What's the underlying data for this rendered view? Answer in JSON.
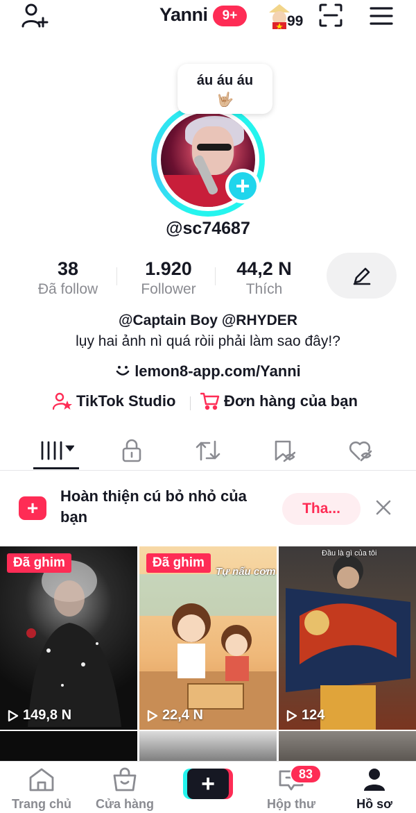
{
  "header": {
    "username": "Yanni",
    "notification_badge": "9+",
    "coin_count": "99",
    "icons": [
      "add-friend-icon",
      "avatar-sticker-icon",
      "scan-icon",
      "menu-icon"
    ]
  },
  "profile": {
    "status_bubble": "áu áu áu",
    "status_emoji": "🤟🏼",
    "handle": "@sc74687",
    "stats": [
      {
        "value": "38",
        "label": "Đã follow"
      },
      {
        "value": "1.920",
        "label": "Follower"
      },
      {
        "value": "44,2 N",
        "label": "Thích"
      }
    ],
    "bio_mentions": "@Captain Boy @RHYDER",
    "bio_text": "lụy hai ảnh nì quá ròii phải làm sao đây!?",
    "link": "lemon8-app.com/Yanni",
    "actions": [
      {
        "label": "TikTok Studio",
        "icon": "studio-icon"
      },
      {
        "label": "Đơn hàng của bạn",
        "icon": "cart-icon"
      }
    ]
  },
  "tabs": [
    {
      "name": "videos",
      "icon": "grid-icon",
      "active": true
    },
    {
      "name": "private",
      "icon": "lock-icon"
    },
    {
      "name": "reposts",
      "icon": "repost-icon"
    },
    {
      "name": "favorites",
      "icon": "bookmark-hidden-icon"
    },
    {
      "name": "liked",
      "icon": "heart-hidden-icon"
    }
  ],
  "banner": {
    "text": "Hoàn thiện cú bỏ nhỏ của bạn",
    "button": "Tha..."
  },
  "videos": [
    {
      "pinned": "Đã ghim",
      "views": "149,8 N"
    },
    {
      "pinned": "Đã ghim",
      "views": "22,4 N",
      "overlay": "Tự nấu cơm"
    },
    {
      "views": "124",
      "overlay": "Đầu là gì của tôi"
    }
  ],
  "bottom_nav": [
    {
      "label": "Trang chủ",
      "icon": "home-icon"
    },
    {
      "label": "Cửa hàng",
      "icon": "shop-icon"
    },
    {
      "label": "",
      "icon": "create-icon"
    },
    {
      "label": "Hộp thư",
      "icon": "inbox-icon",
      "badge": "83"
    },
    {
      "label": "Hồ sơ",
      "icon": "profile-icon",
      "active": true
    }
  ]
}
